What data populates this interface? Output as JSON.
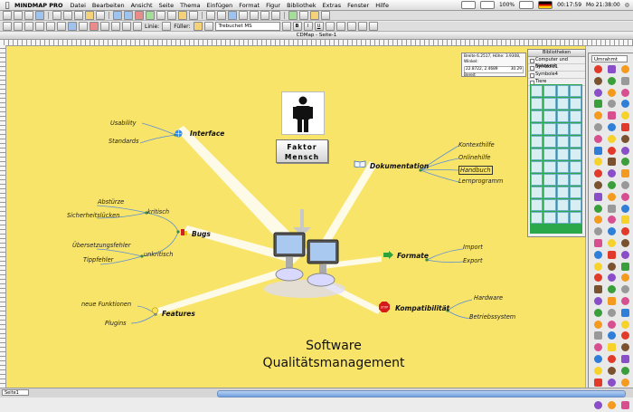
{
  "menu": {
    "apple": "",
    "app": "MINDMAP PRO",
    "items": [
      "Datei",
      "Bearbeiten",
      "Ansicht",
      "Seite",
      "Thema",
      "Einfügen",
      "Format",
      "Figur",
      "Bibliothek",
      "Extras",
      "Fenster",
      "Hilfe"
    ],
    "battery": "100%",
    "time": "00:17:59",
    "clock": "Mo 21:38:00"
  },
  "toolbar": {
    "linie_label": "Linie:",
    "fuller_label": "Füller:",
    "font": "Trebuchet MS"
  },
  "window": {
    "title": "CDMap - Seite-1"
  },
  "status": {
    "zoom": "Seite1"
  },
  "panel": {
    "title": "Bibliotheken",
    "rows": [
      "Computer und Netzwerk",
      "Symbole1",
      "Symbole4",
      "Tiere"
    ]
  },
  "coord": {
    "line1": "Breite 6.2517, Höhe: 3.9308, Winkel:",
    "x": "22.8722, 2.4689",
    "angle": "30.29",
    "line3": "Bereit"
  },
  "iconpalette": {
    "select": "Umrahmt"
  },
  "map": {
    "faktor": [
      "Faktor",
      "Mensch"
    ],
    "central": [
      "Software",
      "Qualitätsmanagement"
    ],
    "topics": {
      "interface": "Interface",
      "bugs": "Bugs",
      "features": "Features",
      "dokumentation": "Dokumentation",
      "formate": "Formate",
      "kompatibilitaet": "Kompatibilität"
    },
    "subs": {
      "usability": "Usability",
      "standards": "Standards",
      "abstuerze": "Abstürze",
      "sicherheit": "Sicherheitslücken",
      "kritisch": "kritisch",
      "uebersetzung": "Übersetzungsfehler",
      "tippfehler": "Tippfehler",
      "unkritisch": "unkritisch",
      "neue": "neue Funktionen",
      "plugins": "Plugins",
      "kontexthilfe": "Kontexthilfe",
      "onlinehilfe": "Onlinehilfe",
      "handbuch": "Handbuch",
      "lernprogramm": "Lernprogramm",
      "import": "Import",
      "export": "Export",
      "hardware": "Hardware",
      "betriebssystem": "Betriebssystem"
    }
  },
  "colors": {
    "canvas": "#f9e46a",
    "branch": "#5b8fd6",
    "library": "#2aa84a"
  }
}
